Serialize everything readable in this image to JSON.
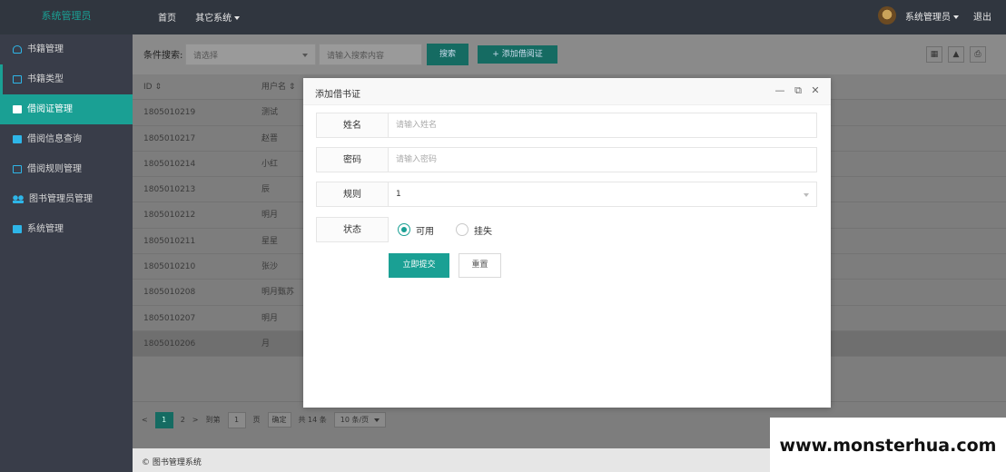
{
  "app": {
    "logo": "系统管理员"
  },
  "topnav": {
    "home": "首页",
    "other": "其它系统"
  },
  "user": {
    "name": "系统管理员",
    "logout": "退出"
  },
  "sidebar": {
    "items": [
      {
        "label": "书籍管理",
        "icon": "books-icon"
      },
      {
        "label": "书籍类型",
        "icon": "category-icon"
      },
      {
        "label": "借阅证管理",
        "icon": "card-icon"
      },
      {
        "label": "借阅信息查询",
        "icon": "query-icon"
      },
      {
        "label": "借阅规则管理",
        "icon": "rules-icon"
      },
      {
        "label": "图书管理员管理",
        "icon": "users-icon"
      },
      {
        "label": "系统管理",
        "icon": "settings-icon"
      }
    ]
  },
  "toolbar": {
    "label": "条件搜索:",
    "select_placeholder": "请选择",
    "search_placeholder": "请输入搜索内容",
    "search_btn": "搜索",
    "add_btn": "+ 添加借阅证"
  },
  "table": {
    "headers": [
      "ID ⇕",
      "用户名 ⇕"
    ],
    "rows": [
      [
        "1805010219",
        "测试"
      ],
      [
        "1805010217",
        "赵晋"
      ],
      [
        "1805010214",
        "小红"
      ],
      [
        "1805010213",
        "辰"
      ],
      [
        "1805010212",
        "明月"
      ],
      [
        "1805010211",
        "星星"
      ],
      [
        "1805010210",
        "张沙"
      ],
      [
        "1805010208",
        "明月甄苏"
      ],
      [
        "1805010207",
        "明月"
      ],
      [
        "1805010206",
        "月"
      ]
    ]
  },
  "pager": {
    "prev": "<",
    "current": "1",
    "next_page": "2",
    "next": ">",
    "goto": "到第",
    "goto_value": "1",
    "page_unit": "页",
    "confirm": "确定",
    "total": "共 14 条",
    "page_size": "10 条/页"
  },
  "footer": {
    "text": "© 图书管理系统"
  },
  "modal": {
    "title": "添加借书证",
    "fields": {
      "name_label": "姓名",
      "name_placeholder": "请输入姓名",
      "password_label": "密码",
      "password_placeholder": "请输入密码",
      "rule_label": "规则",
      "rule_value": "1",
      "status_label": "状态",
      "status_opt1": "可用",
      "status_opt2": "挂失"
    },
    "submit": "立即提交",
    "reset": "重置"
  },
  "watermark": "www.monsterhua.com",
  "colors": {
    "accent": "#1aa094",
    "header_bg": "#30363f",
    "sidebar_bg": "#393d49"
  }
}
